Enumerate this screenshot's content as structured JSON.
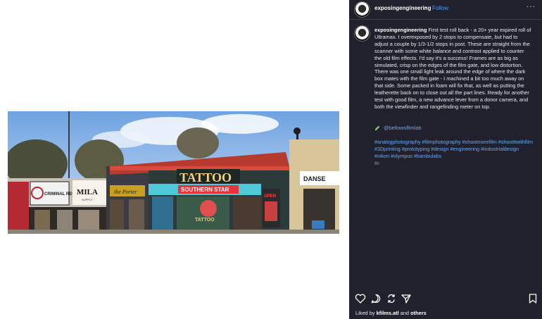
{
  "post": {
    "username": "exposingengineering",
    "separator": "•",
    "follow_label": "Follow",
    "more_label": "···",
    "caption_username": "exposingengineering",
    "caption_text": "First test roll back - a 20+ year expired roll of Ultramax. I overexposed by 2 stops to compensate, but had to adjust a couple by 1/3-1/2 stops in post. These are straight from the scanner with some white balance and contrast applied to counter the old film effects. I'd say it's a success! Frames are as big as simulated, crisp on the edges of the film gate, and low distortion. There was one small light leak around the edge of where the dark box mates with the film gate - I machined a bit too much away on that side. Some packed in foam will fix that, as well as putting the leatherette back on to close out all the part lines. Ready for another test with good film, a new advance lever from a donor camera, and both the viewfinder and rangefinding meter on top.",
    "mention": "@bellowsfilmlab",
    "tags": "#analogphotography #filmphotography #shootmorefilm #shootitwithfilm #3Dprinting #prototyping #design #engineering #industrialdesign #nikon #olympus #bambulabs",
    "time": "6h",
    "liked_prefix": "Liked by",
    "liked_user": "kfilms.atl",
    "liked_and": "and",
    "liked_others": "others"
  },
  "photo": {
    "signs": {
      "criminal": "CRIMINAL RECORDS",
      "mila": "MILA",
      "mila_sub": "SUPPLY",
      "porter": "the Porter",
      "tattoo": "TATTOO",
      "southern_star": "SOUTHERN STAR",
      "open": "OPEN",
      "tattoo_window": "TATTOO",
      "danse": "DANSE"
    }
  },
  "icons": {
    "avatar": "avatar",
    "more": "more-horizontal-icon",
    "pencil": "pencil-icon",
    "like": "heart-icon",
    "comment": "comment-icon",
    "repost": "repost-icon",
    "share": "share-icon",
    "save": "bookmark-icon"
  },
  "colors": {
    "panel_bg": "#21212e",
    "link": "#4c9bf5",
    "hashtag": "#6aa8f0"
  }
}
